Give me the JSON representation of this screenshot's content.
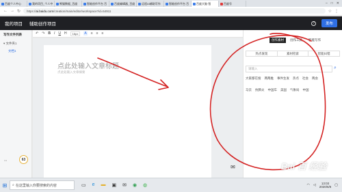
{
  "browser": {
    "tabs": [
      {
        "label": "百度个人中心",
        "active": false
      },
      {
        "label": "我的项目_个人中",
        "active": false
      },
      {
        "label": "熊猫数据_百度",
        "active": false
      },
      {
        "label": "智能创作平台 百",
        "active": false
      },
      {
        "label": "百度编辑器_百度",
        "active": false
      },
      {
        "label": "远程AI辅助写作",
        "active": false
      },
      {
        "label": "智能创作平台 百",
        "active": false
      },
      {
        "label": "百度大脑·智",
        "active": true
      },
      {
        "label": "百度号",
        "active": false
      }
    ],
    "url_prefix": "https://",
    "url_host": "ai.baidu.com",
    "url_path": "/creation/main/editor/workspace?id=54911"
  },
  "header": {
    "project": "我的项目",
    "current": "辅助创作项目",
    "help": "?",
    "publish": "发布"
  },
  "sidebar": {
    "title": "写作文件列表",
    "folder": "文件夹1",
    "doc": "文档1",
    "score": "63"
  },
  "toolbar": {
    "items": [
      "↶",
      "↷",
      "B",
      "I",
      "U",
      "H",
      "A",
      "≡",
      "≡",
      "≡"
    ],
    "size_label": "16px"
  },
  "editor": {
    "title_placeholder": "点此处输入文章标题",
    "subtitle_placeholder": "点此处输入文章摘要"
  },
  "right_panel": {
    "tabs": [
      "创作素材",
      "创作工具",
      "智能写作"
    ],
    "segments": [
      "热点发现",
      "素材检索",
      "智能纠错"
    ],
    "search_placeholder": "请输入",
    "row1": [
      "大家都在搜",
      "两两推",
      "事件生发",
      "热点",
      "社会",
      "两会"
    ],
    "row2": [
      "马云",
      "抗肺炎",
      "中国车",
      "美国",
      "气象局",
      "中国"
    ]
  },
  "watermark": {
    "text": "Bai 百 经验",
    "sub": "jingyan.baidu.com"
  },
  "taskbar": {
    "search_placeholder": "在这里输入你要搜索的内容",
    "time": "13:03",
    "date": "2020/6/8"
  },
  "colors": {
    "accent": "#2f6fe4",
    "annotation": "#d42222",
    "header_bg": "#1f2024"
  }
}
